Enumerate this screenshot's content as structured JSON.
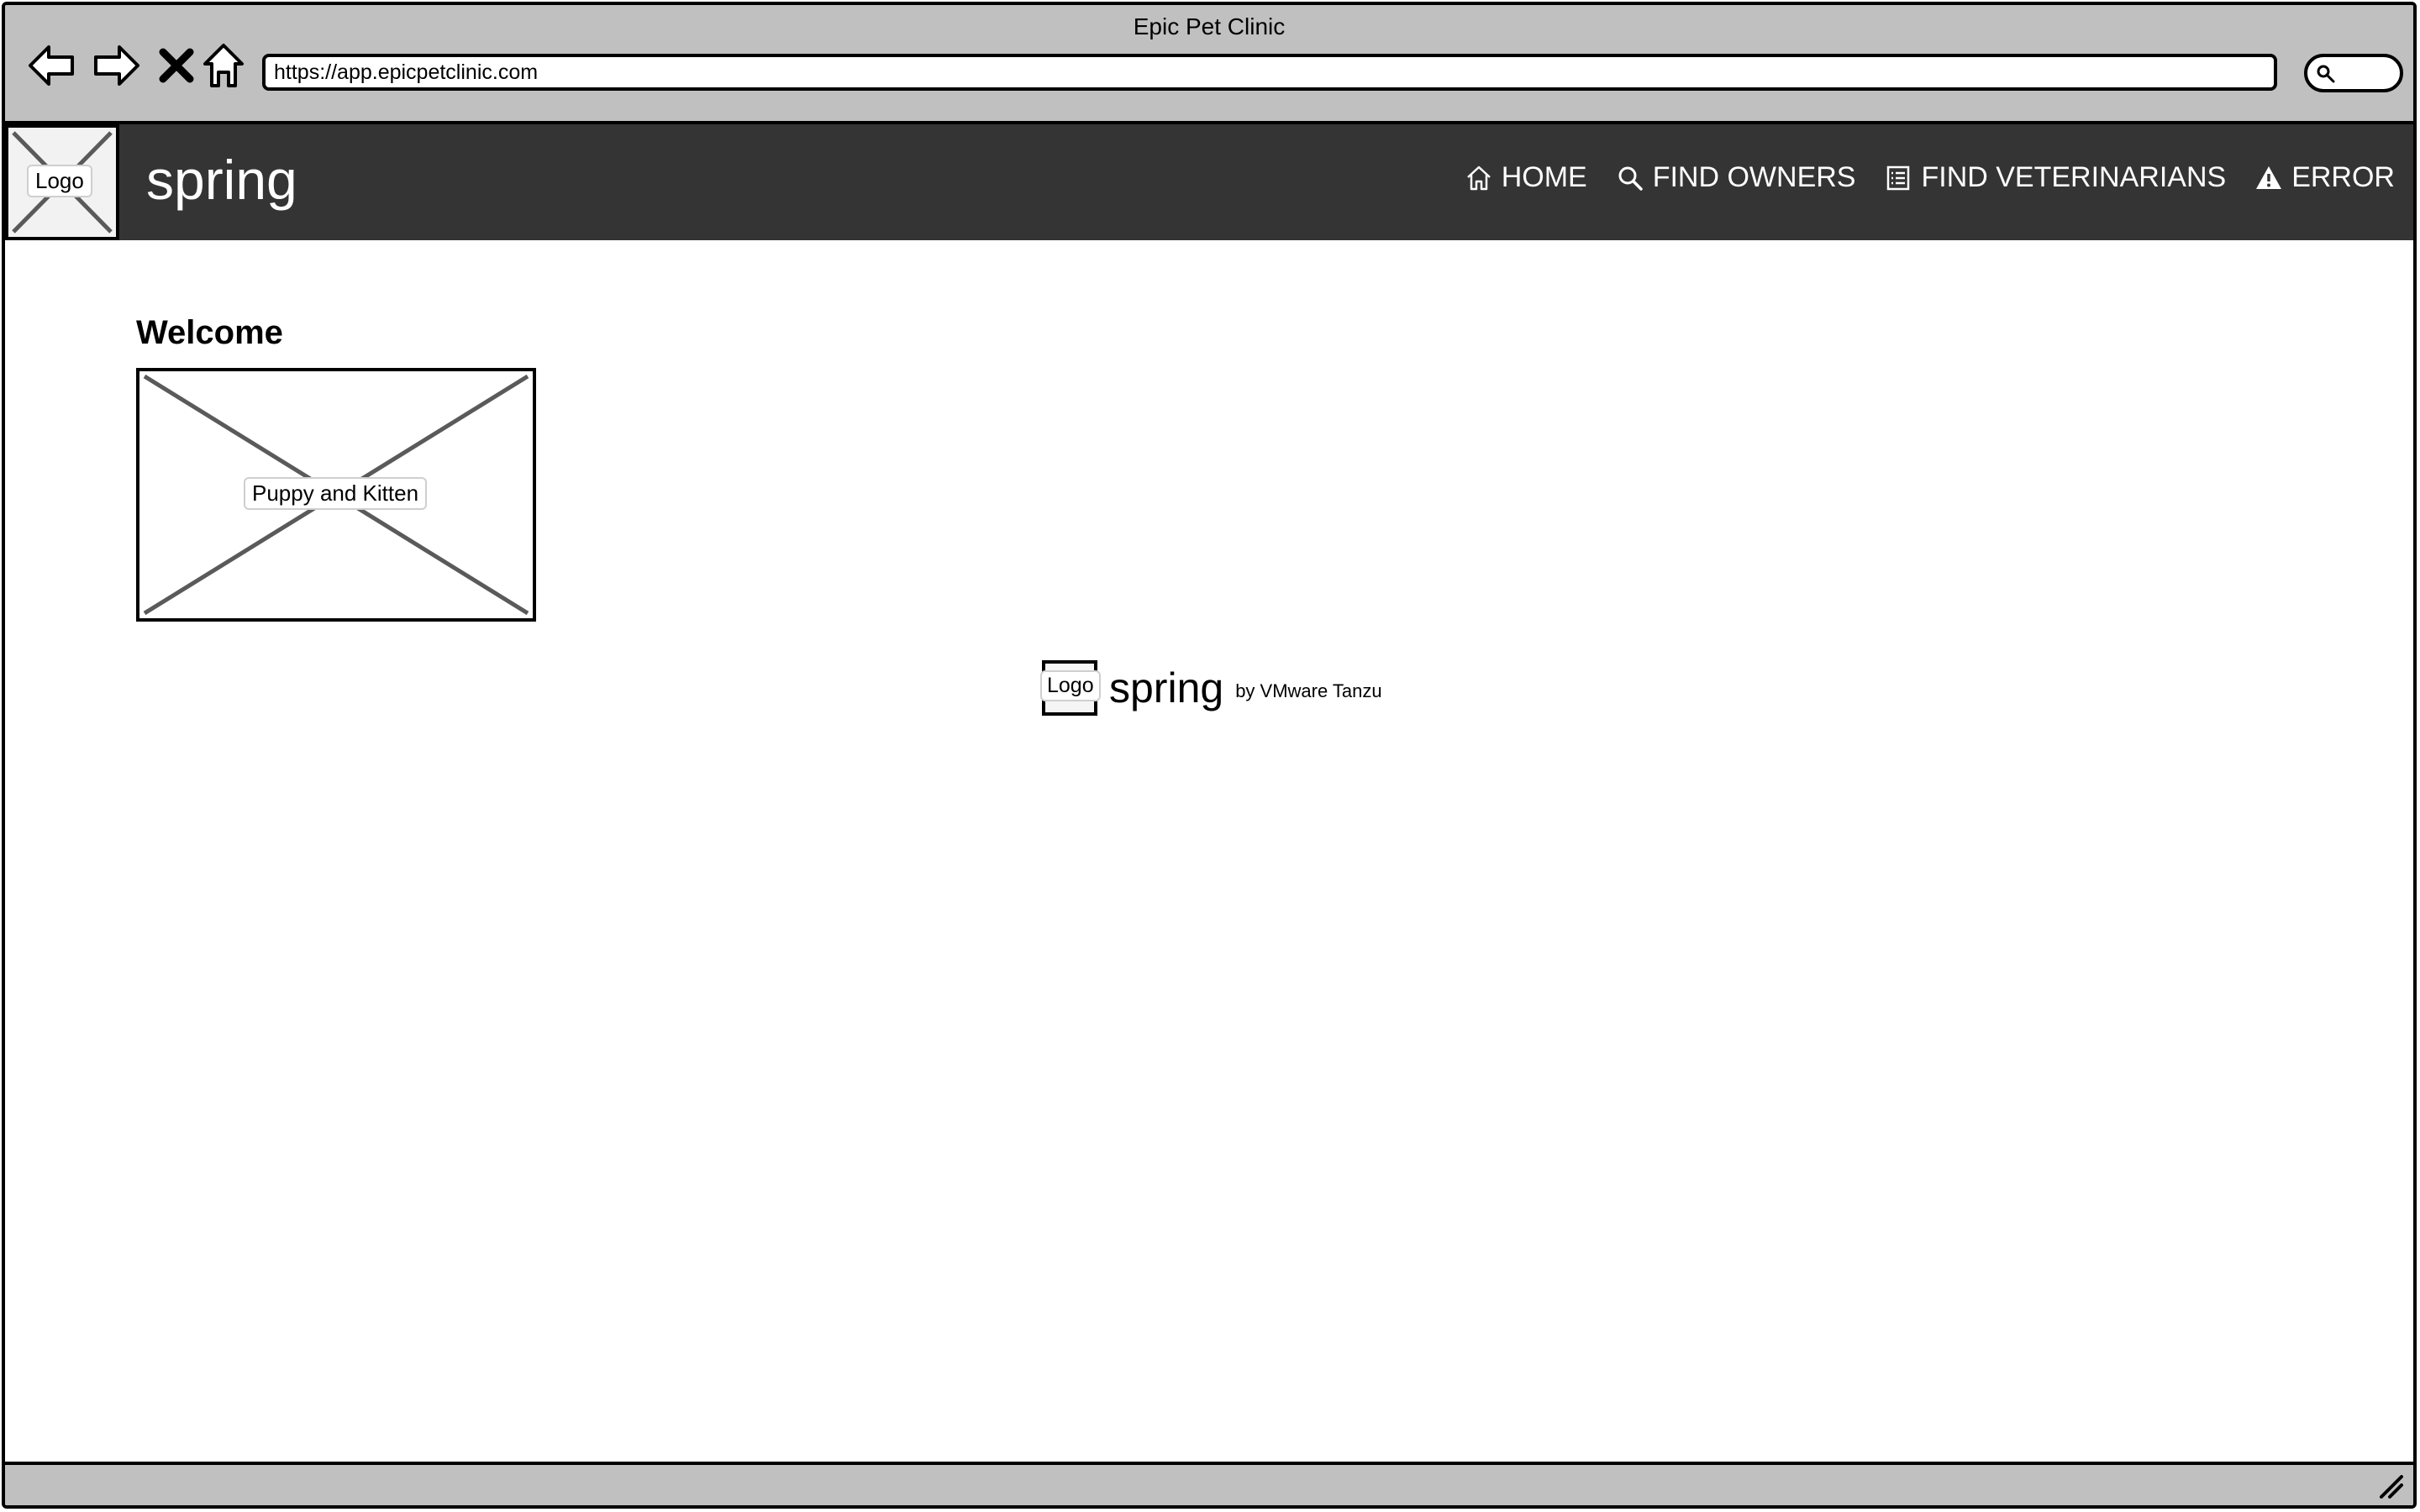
{
  "window": {
    "title": "Epic Pet Clinic"
  },
  "browser": {
    "url": "https://app.epicpetclinic.com",
    "icons": [
      "back-arrow-icon",
      "forward-arrow-icon",
      "close-icon",
      "home-icon",
      "search-icon"
    ]
  },
  "header": {
    "logo_label": "Logo",
    "brand": "spring",
    "nav": [
      {
        "label": "HOME",
        "icon": "home-icon"
      },
      {
        "label": "FIND OWNERS",
        "icon": "search-icon"
      },
      {
        "label": "FIND VETERINARIANS",
        "icon": "list-icon"
      },
      {
        "label": "ERROR",
        "icon": "warning-icon"
      }
    ],
    "background_color": "#343434"
  },
  "main": {
    "heading": "Welcome",
    "image_label": "Puppy and Kitten"
  },
  "footer": {
    "logo_label": "Logo",
    "brand": "spring",
    "byline": "by VMware Tanzu"
  },
  "colors": {
    "chrome": "#c0c0c0",
    "header": "#343434",
    "page": "#ffffff"
  }
}
